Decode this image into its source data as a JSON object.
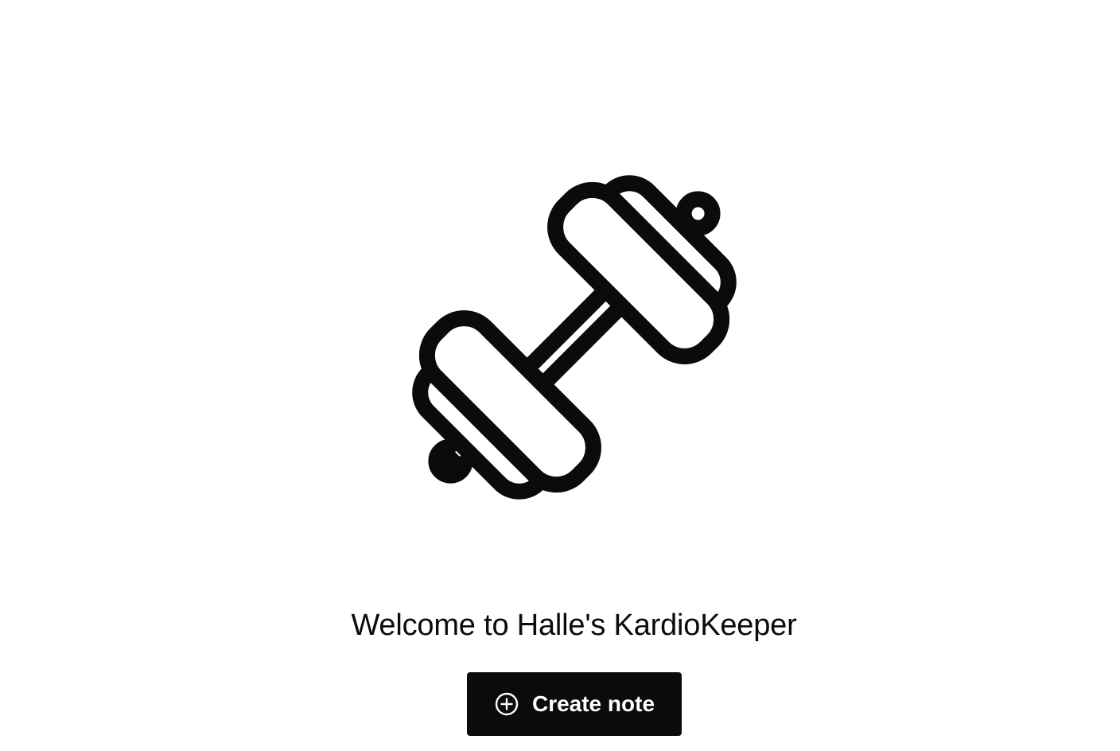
{
  "hero": {
    "icon": "dumbbell-icon"
  },
  "welcome": {
    "title": "Welcome to Halle's KardioKeeper"
  },
  "actions": {
    "create_note": {
      "label": "Create note",
      "icon": "plus-circle-icon"
    }
  },
  "colors": {
    "primary": "#0b0b0b",
    "background": "#ffffff",
    "button_text": "#ffffff"
  }
}
